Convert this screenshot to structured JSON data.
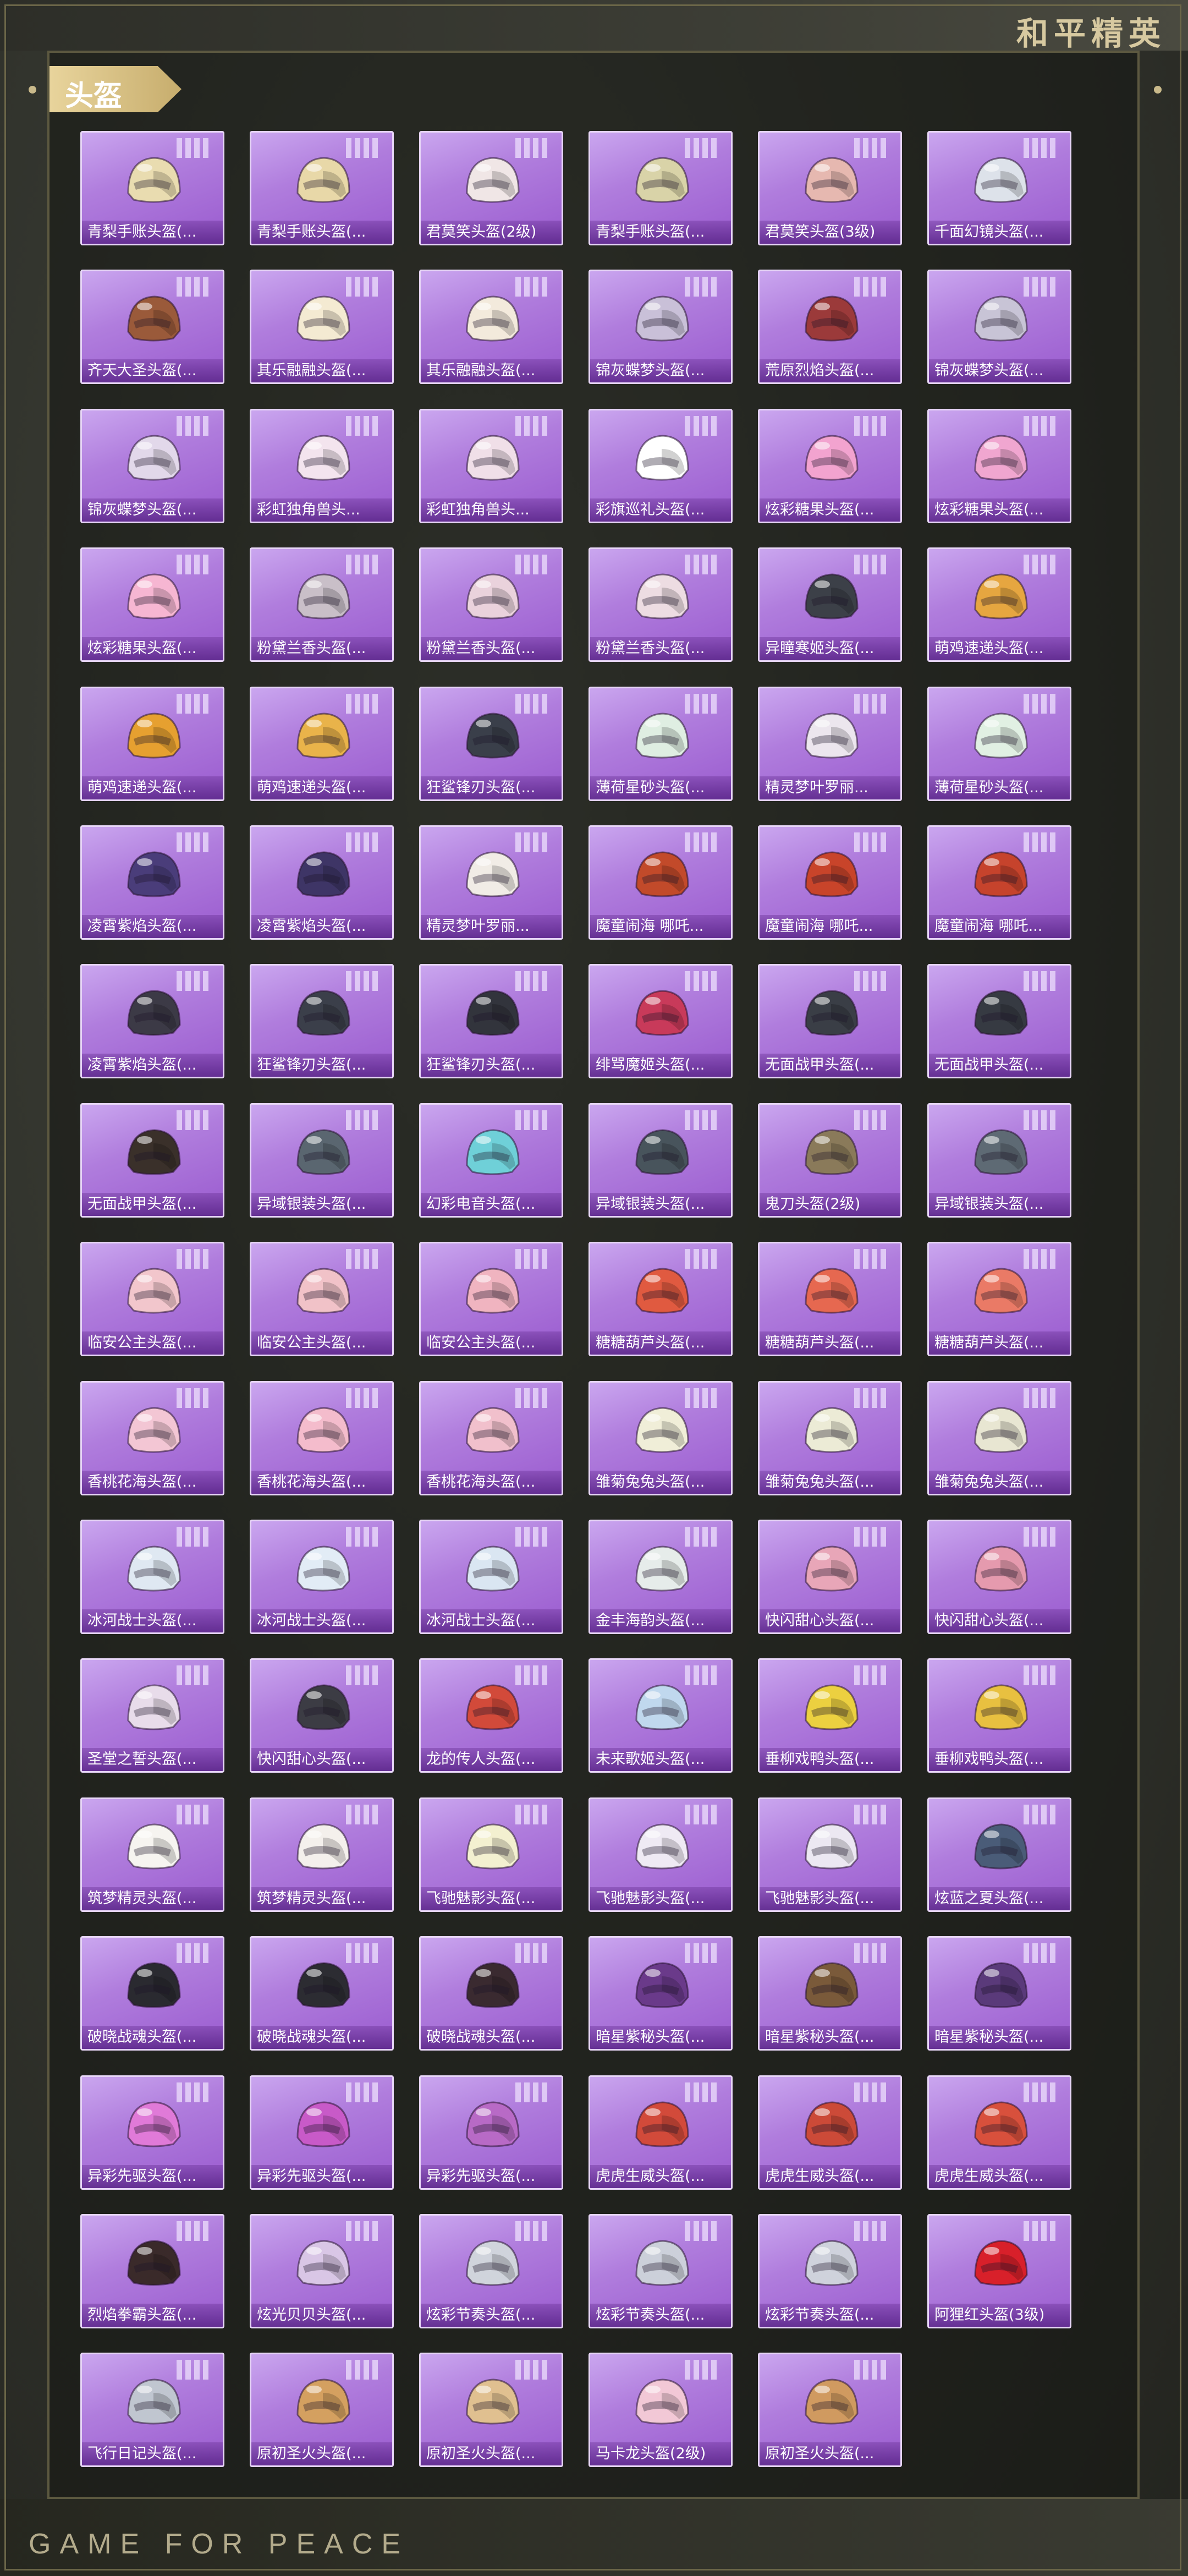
{
  "brand": "和平精英",
  "footer": "GAME FOR PEACE",
  "section": {
    "title": "头盔"
  },
  "colors": {
    "tile_purple": "#b07ddd",
    "tag_gold": "#d9c080",
    "frame": "#5c5840"
  },
  "items": [
    {
      "name": "青梨手账头盔(..."
    },
    {
      "name": "青梨手账头盔(..."
    },
    {
      "name": "君莫笑头盔(2级)"
    },
    {
      "name": "青梨手账头盔(..."
    },
    {
      "name": "君莫笑头盔(3级)"
    },
    {
      "name": "千面幻镜头盔(..."
    },
    {
      "name": "齐天大圣头盔(..."
    },
    {
      "name": "其乐融融头盔(..."
    },
    {
      "name": "其乐融融头盔(..."
    },
    {
      "name": "锦灰蝶梦头盔(..."
    },
    {
      "name": "荒原烈焰头盔(..."
    },
    {
      "name": "锦灰蝶梦头盔(..."
    },
    {
      "name": "锦灰蝶梦头盔(..."
    },
    {
      "name": "彩虹独角兽头..."
    },
    {
      "name": "彩虹独角兽头..."
    },
    {
      "name": "彩旗巡礼头盔(..."
    },
    {
      "name": "炫彩糖果头盔(..."
    },
    {
      "name": "炫彩糖果头盔(..."
    },
    {
      "name": "炫彩糖果头盔(..."
    },
    {
      "name": "粉黛兰香头盔(..."
    },
    {
      "name": "粉黛兰香头盔(..."
    },
    {
      "name": "粉黛兰香头盔(..."
    },
    {
      "name": "异瞳寒姬头盔(..."
    },
    {
      "name": "萌鸡速递头盔(..."
    },
    {
      "name": "萌鸡速递头盔(..."
    },
    {
      "name": "萌鸡速递头盔(..."
    },
    {
      "name": "狂鲨锋刃头盔(..."
    },
    {
      "name": "薄荷星砂头盔(..."
    },
    {
      "name": "精灵梦叶罗丽..."
    },
    {
      "name": "薄荷星砂头盔(..."
    },
    {
      "name": "凌霄紫焰头盔(..."
    },
    {
      "name": "凌霄紫焰头盔(..."
    },
    {
      "name": "精灵梦叶罗丽..."
    },
    {
      "name": "魔童闹海 哪吒..."
    },
    {
      "name": "魔童闹海 哪吒..."
    },
    {
      "name": "魔童闹海 哪吒..."
    },
    {
      "name": "凌霄紫焰头盔(..."
    },
    {
      "name": "狂鲨锋刃头盔(..."
    },
    {
      "name": "狂鲨锋刃头盔(..."
    },
    {
      "name": "绯骂魔姬头盔(..."
    },
    {
      "name": "无面战甲头盔(..."
    },
    {
      "name": "无面战甲头盔(..."
    },
    {
      "name": "无面战甲头盔(..."
    },
    {
      "name": "异域银装头盔(..."
    },
    {
      "name": "幻彩电音头盔(..."
    },
    {
      "name": "异域银装头盔(..."
    },
    {
      "name": "鬼刀头盔(2级)"
    },
    {
      "name": "异域银装头盔(..."
    },
    {
      "name": "临安公主头盔(..."
    },
    {
      "name": "临安公主头盔(..."
    },
    {
      "name": "临安公主头盔(..."
    },
    {
      "name": "糖糖葫芦头盔(..."
    },
    {
      "name": "糖糖葫芦头盔(..."
    },
    {
      "name": "糖糖葫芦头盔(..."
    },
    {
      "name": "香桃花海头盔(..."
    },
    {
      "name": "香桃花海头盔(..."
    },
    {
      "name": "香桃花海头盔(..."
    },
    {
      "name": "雏菊兔兔头盔(..."
    },
    {
      "name": "雏菊兔兔头盔(..."
    },
    {
      "name": "雏菊兔兔头盔(..."
    },
    {
      "name": "冰河战士头盔(..."
    },
    {
      "name": "冰河战士头盔(..."
    },
    {
      "name": "冰河战士头盔(..."
    },
    {
      "name": "金丰海韵头盔(..."
    },
    {
      "name": "快闪甜心头盔(..."
    },
    {
      "name": "快闪甜心头盔(..."
    },
    {
      "name": "圣堂之誓头盔(..."
    },
    {
      "name": "快闪甜心头盔(..."
    },
    {
      "name": "龙的传人头盔(..."
    },
    {
      "name": "未来歌姬头盔(..."
    },
    {
      "name": "垂柳戏鸭头盔(..."
    },
    {
      "name": "垂柳戏鸭头盔(..."
    },
    {
      "name": "筑梦精灵头盔(..."
    },
    {
      "name": "筑梦精灵头盔(..."
    },
    {
      "name": "飞驰魅影头盔(..."
    },
    {
      "name": "飞驰魅影头盔(..."
    },
    {
      "name": "飞驰魅影头盔(..."
    },
    {
      "name": "炫蓝之夏头盔(..."
    },
    {
      "name": "破晓战魂头盔(..."
    },
    {
      "name": "破晓战魂头盔(..."
    },
    {
      "name": "破晓战魂头盔(..."
    },
    {
      "name": "暗星紫秘头盔(..."
    },
    {
      "name": "暗星紫秘头盔(..."
    },
    {
      "name": "暗星紫秘头盔(..."
    },
    {
      "name": "异彩先驱头盔(..."
    },
    {
      "name": "异彩先驱头盔(..."
    },
    {
      "name": "异彩先驱头盔(..."
    },
    {
      "name": "虎虎生威头盔(..."
    },
    {
      "name": "虎虎生威头盔(..."
    },
    {
      "name": "虎虎生威头盔(..."
    },
    {
      "name": "烈焰拳霸头盔(..."
    },
    {
      "name": "炫光贝贝头盔(..."
    },
    {
      "name": "炫彩节奏头盔(..."
    },
    {
      "name": "炫彩节奏头盔(..."
    },
    {
      "name": "炫彩节奏头盔(..."
    },
    {
      "name": "阿狸红头盔(3级)"
    },
    {
      "name": "飞行日记头盔(..."
    },
    {
      "name": "原初圣火头盔(..."
    },
    {
      "name": "原初圣火头盔(..."
    },
    {
      "name": "马卡龙头盔(2级)"
    },
    {
      "name": "原初圣火头盔(..."
    }
  ],
  "helmet_colors": [
    "#e9dcb0",
    "#e8d8a8",
    "#f0e6e6",
    "#d9d3a8",
    "#e6b8b0",
    "#dde2ea",
    "#9a5a3a",
    "#f4ead2",
    "#f3eadc",
    "#c9c0d8",
    "#9b3a3a",
    "#c8c4d6",
    "#e2d8ea",
    "#f3e4ee",
    "#f0dfe8",
    "#ffffff",
    "#f2a3cf",
    "#f0a6d0",
    "#f6b6d2",
    "#c9bfc8",
    "#ead2dc",
    "#eddce2",
    "#3c4048",
    "#e6a640",
    "#e6a030",
    "#e9b34a",
    "#3a3f4a",
    "#dfeee2",
    "#ece6ee",
    "#e1f0e3",
    "#4a3d7a",
    "#3e3566",
    "#f1ece6",
    "#c24a2a",
    "#c8442a",
    "#c6432c",
    "#3c3a46",
    "#3b3f4a",
    "#32343c",
    "#c83a5a",
    "#3a3e46",
    "#363a42",
    "#3a302a",
    "#5a6670",
    "#6fd0d8",
    "#48545c",
    "#8a7a5a",
    "#5e6a74",
    "#f2c6cc",
    "#f1c2c8",
    "#f0b4c0",
    "#e05a40",
    "#e66850",
    "#ea7a66",
    "#f3c6d4",
    "#f4bccc",
    "#f1c0cc",
    "#f0eed8",
    "#ecebd6",
    "#e8e6d2",
    "#dfe8f2",
    "#e2ecf6",
    "#dae6f2",
    "#e6ecea",
    "#e8a6b8",
    "#e59aae",
    "#e8dcea",
    "#3c3c44",
    "#d24a3a",
    "#c0d8ee",
    "#ecd040",
    "#e8c040",
    "#f6f4f0",
    "#f4f0ec",
    "#f3f0d0",
    "#efeaf4",
    "#ece8f2",
    "#4a5c78",
    "#2a2a30",
    "#2c2c32",
    "#3a2a30",
    "#6a3a8a",
    "#7a5a3a",
    "#5a3a7a",
    "#e07ad8",
    "#c85ac8",
    "#b86ac6",
    "#d24a3a",
    "#cc4a38",
    "#d8503c",
    "#3a2a2a",
    "#d9c6e6",
    "#d0d4dc",
    "#ccd0da",
    "#cfd2dc",
    "#d8202a",
    "#c0c6d0",
    "#d4a060",
    "#e0c090",
    "#f2c8d6",
    "#d09a60"
  ]
}
